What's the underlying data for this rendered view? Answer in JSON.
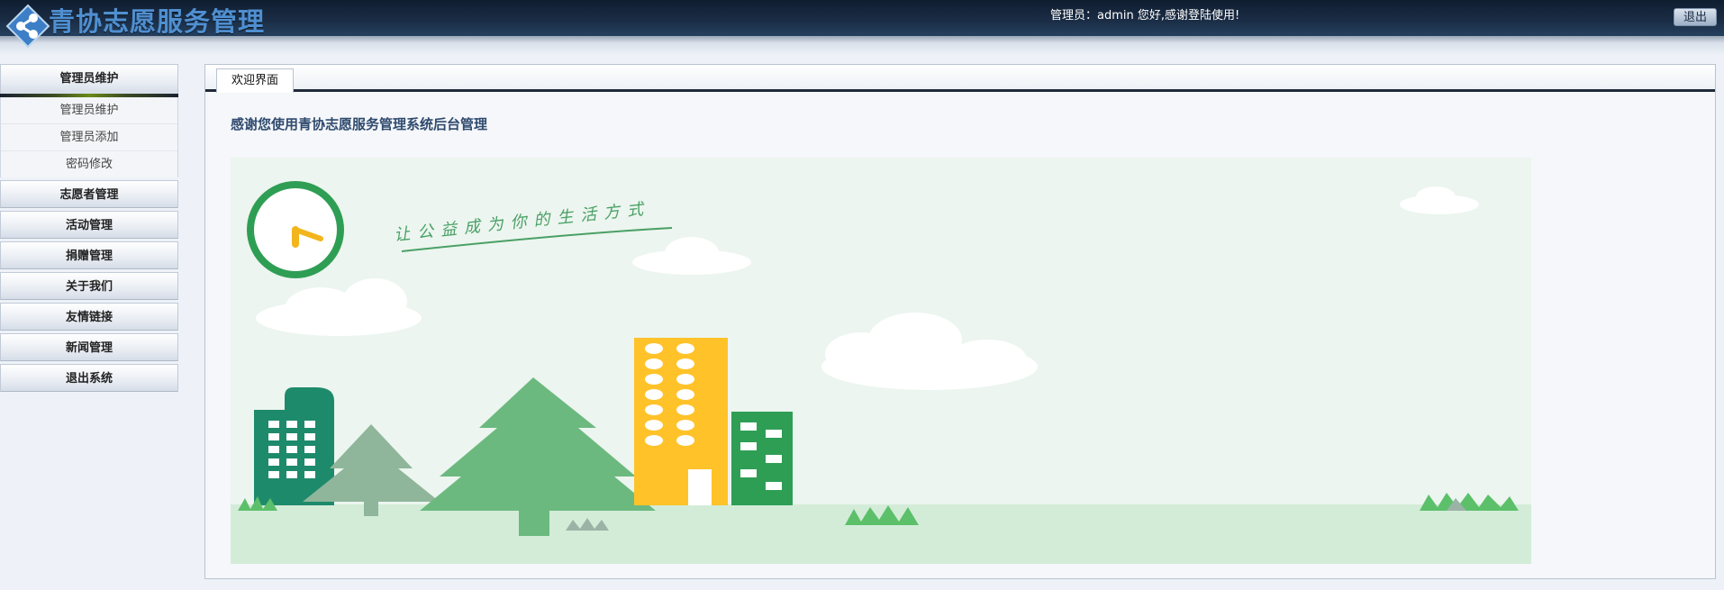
{
  "header": {
    "app_title": "青协志愿服务管理",
    "welcome_text": "管理员：admin 您好,感谢登陆使用!",
    "logout_label": "退出",
    "logo_icon": "share-node-icon"
  },
  "sidebar": {
    "groups": [
      {
        "label": "管理员维护",
        "expanded": true,
        "items": [
          {
            "label": "管理员维护"
          },
          {
            "label": "管理员添加"
          },
          {
            "label": "密码修改"
          }
        ]
      },
      {
        "label": "志愿者管理"
      },
      {
        "label": "活动管理"
      },
      {
        "label": "捐赠管理"
      },
      {
        "label": "关于我们"
      },
      {
        "label": "友情链接"
      },
      {
        "label": "新闻管理"
      },
      {
        "label": "退出系统"
      }
    ]
  },
  "main": {
    "tabs": [
      {
        "label": "欢迎界面",
        "active": true
      }
    ],
    "thanks_text": "感谢您使用青协志愿服务管理系统后台管理",
    "banner_slogan": "让公益成为你的生活方式",
    "colors": {
      "accent": "#4f8fd0",
      "building_teal": "#1e8a6c",
      "tree_green": "#6cb97f",
      "building_yellow": "#ffc229",
      "clock_ring": "#2f9e55"
    }
  }
}
